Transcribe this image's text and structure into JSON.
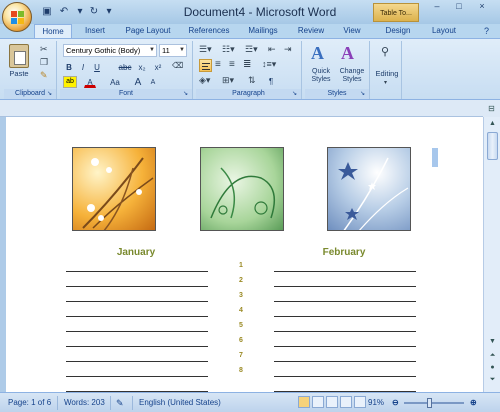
{
  "window": {
    "title": "Document4 - Microsoft Word",
    "context_tab": "Table To..."
  },
  "tabs": [
    "Home",
    "Insert",
    "Page Layout",
    "References",
    "Mailings",
    "Review",
    "View",
    "Design",
    "Layout"
  ],
  "ribbon": {
    "clipboard": {
      "label": "Clipboard",
      "paste": "Paste"
    },
    "font": {
      "label": "Font",
      "font_name": "Century Gothic (Body)",
      "font_size": "11",
      "bold": "B",
      "italic": "I",
      "underline": "U",
      "strike": "abc",
      "sub": "x₂",
      "sup": "x²",
      "grow": "A",
      "shrink": "A",
      "case": "Aa",
      "color": "A"
    },
    "paragraph": {
      "label": "Paragraph",
      "pilcrow": "¶"
    },
    "styles": {
      "label": "Styles",
      "quick": "Quick",
      "quick2": "Styles",
      "change": "Change",
      "change2": "Styles"
    },
    "editing": {
      "label": "Editing"
    }
  },
  "document": {
    "months": [
      "January",
      "February"
    ],
    "numbers": [
      "1",
      "2",
      "3",
      "4",
      "5",
      "6",
      "7",
      "8"
    ]
  },
  "status": {
    "page": "Page: 1 of 6",
    "words": "Words: 203",
    "language": "English (United States)",
    "zoom": "91%"
  },
  "colors": {
    "accent": "#7a8a2e",
    "ribbon": "#dfedfa",
    "numbers": "#9a8a24"
  }
}
